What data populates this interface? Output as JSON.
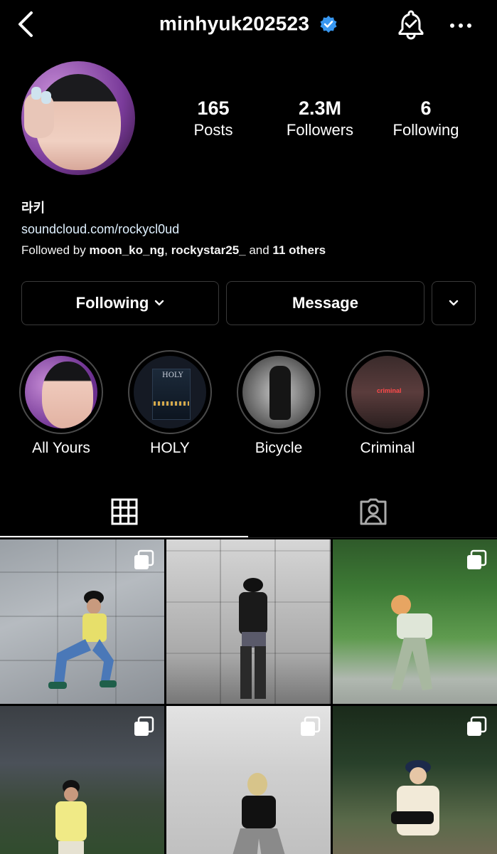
{
  "header": {
    "username": "minhyuk202523",
    "verified": true,
    "back_icon": "chevron-left-icon",
    "bell_icon": "bell-check-icon",
    "more_icon": "more-horizontal-icon"
  },
  "profile": {
    "stats": [
      {
        "value": "165",
        "label": "Posts"
      },
      {
        "value": "2.3M",
        "label": "Followers"
      },
      {
        "value": "6",
        "label": "Following"
      }
    ],
    "name": "라키",
    "link": "soundcloud.com/rockycl0ud",
    "followed_by": {
      "prefix": "Followed by ",
      "user1": "moon_ko_ng",
      "sep": ", ",
      "user2": "rockystar25_",
      "mid": " and ",
      "others": "11 others"
    }
  },
  "actions": {
    "following_label": "Following",
    "message_label": "Message"
  },
  "highlights": [
    {
      "label": "All Yours"
    },
    {
      "label": "HOLY"
    },
    {
      "label": "Bicycle"
    },
    {
      "label": "Criminal"
    }
  ],
  "highlight_thumb_text": {
    "holy_cover": "HOLY",
    "criminal_cover": "criminal"
  },
  "tabs": [
    {
      "name": "grid",
      "icon": "grid-icon",
      "active": true
    },
    {
      "name": "tagged",
      "icon": "tagged-person-icon",
      "active": false
    }
  ],
  "posts": [
    {
      "multi": true
    },
    {
      "multi": false
    },
    {
      "multi": true
    },
    {
      "multi": true
    },
    {
      "multi": true
    },
    {
      "multi": true
    }
  ],
  "colors": {
    "background": "#000000",
    "verified_blue": "#3897f0",
    "button_border": "#3a3a3a",
    "link": "#e0f1ff"
  }
}
